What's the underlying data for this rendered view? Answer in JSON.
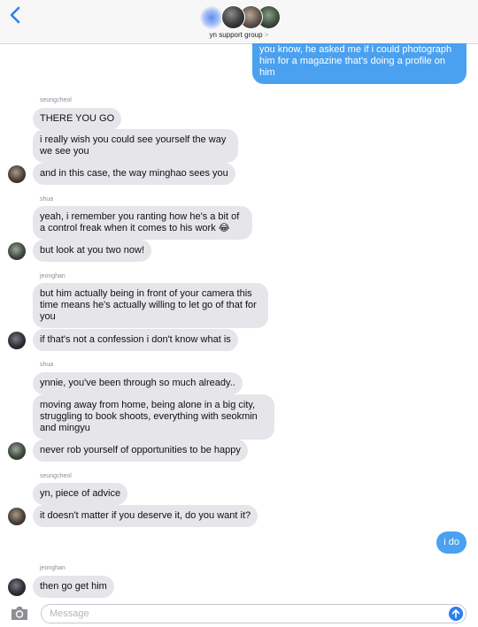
{
  "header": {
    "group_name": "yn support group",
    "chevron": ">"
  },
  "messages": [
    {
      "id": "m1",
      "direction": "outgoing",
      "text": "you know, he asked me if i could photograph him for a magazine that's doing a profile on him"
    },
    {
      "id": "m2",
      "direction": "incoming",
      "sender": "seungcheol",
      "text": "THERE YOU GO"
    },
    {
      "id": "m3",
      "direction": "incoming",
      "text": "i really wish you could see yourself the way we see you"
    },
    {
      "id": "m4",
      "direction": "incoming",
      "text": "and in this case, the way minghao sees you",
      "avatar": true
    },
    {
      "id": "m5",
      "direction": "incoming",
      "sender": "shua",
      "text": "yeah, i remember you ranting how he's a bit of a control freak when it comes to his work 😂"
    },
    {
      "id": "m6",
      "direction": "incoming",
      "text": "but look at you two now!",
      "avatar": true
    },
    {
      "id": "m7",
      "direction": "incoming",
      "sender": "jeonghan",
      "text": "but him actually being in front of your camera this time means he's actually willing to let go of that for you"
    },
    {
      "id": "m8",
      "direction": "incoming",
      "text": "if that's not a confession i don't know what is",
      "avatar": true
    },
    {
      "id": "m9",
      "direction": "incoming",
      "sender": "shua",
      "text": "ynnie, you've been through so much already.."
    },
    {
      "id": "m10",
      "direction": "incoming",
      "text": "moving away from home, being alone in a big city, struggling to book shoots, everything with seokmin and mingyu"
    },
    {
      "id": "m11",
      "direction": "incoming",
      "text": "never rob yourself of opportunities to be happy",
      "avatar": true
    },
    {
      "id": "m12",
      "direction": "incoming",
      "sender": "seungcheol",
      "text": "yn, piece of advice"
    },
    {
      "id": "m13",
      "direction": "incoming",
      "text": "it doesn't matter if you deserve it, do you want it?",
      "avatar": true
    },
    {
      "id": "m14",
      "direction": "outgoing",
      "text": "i do"
    },
    {
      "id": "m15",
      "direction": "incoming",
      "sender": "jeonghan",
      "text": "then go get him",
      "avatar": true
    }
  ],
  "composer": {
    "placeholder": "Message"
  },
  "colors": {
    "incoming_bubble": "#e5e5ea",
    "outgoing_bubble": "#4aa1f0",
    "accent": "#2f7ff0"
  },
  "icons": [
    "back-chevron-icon",
    "camera-icon",
    "send-arrow-icon"
  ]
}
